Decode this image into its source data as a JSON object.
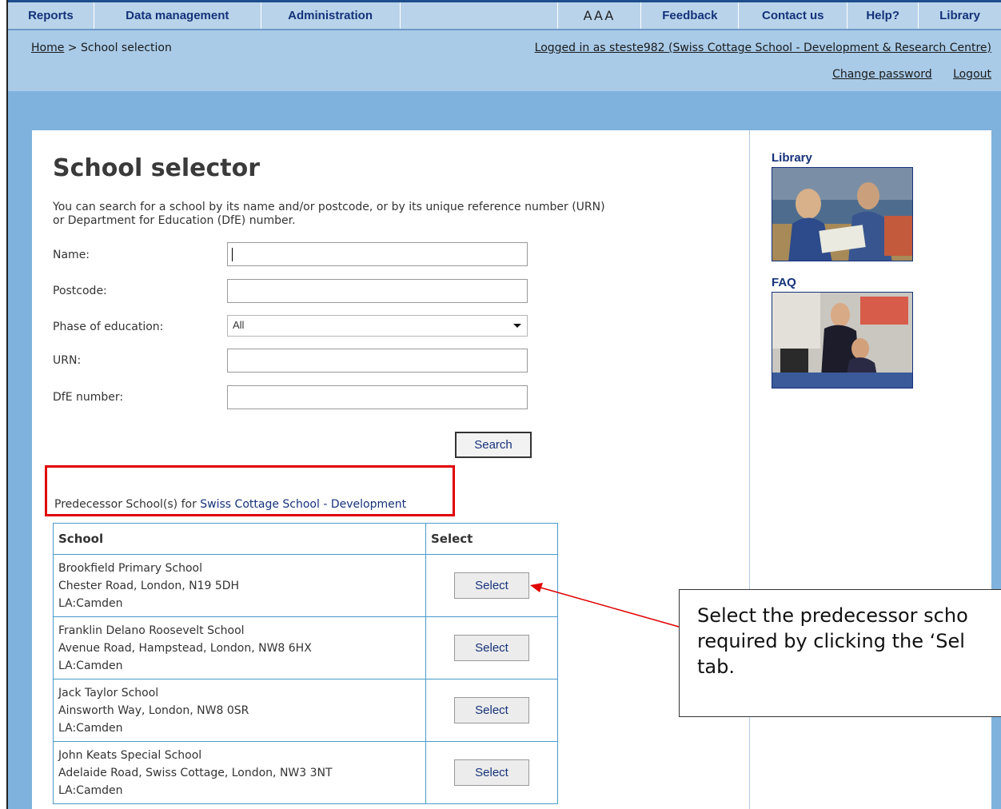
{
  "nav": {
    "items": [
      "Reports",
      "Data management",
      "Administration"
    ],
    "text_size": "AAA",
    "right_items": [
      "Feedback",
      "Contact us",
      "Help?",
      "Library"
    ]
  },
  "breadcrumb": {
    "home": "Home",
    "separator": ">",
    "current": "School selection"
  },
  "account": {
    "login_text": "Logged in as steste982 (Swiss Cottage School - Development & Research Centre)",
    "change_password": "Change password",
    "logout": "Logout"
  },
  "page": {
    "title": "School selector",
    "intro": "You can search for a school by its name and/or postcode, or by its unique reference number (URN) or Department for Education (DfE) number."
  },
  "form": {
    "name_label": "Name:",
    "name_value": "",
    "postcode_label": "Postcode:",
    "postcode_value": "",
    "phase_label": "Phase of education:",
    "phase_value": "All",
    "urn_label": "URN:",
    "urn_value": "",
    "dfe_label": "DfE number:",
    "dfe_value": "",
    "search_button": "Search"
  },
  "predecessor": {
    "prefix": "Predecessor School(s) for",
    "school_name": "Swiss Cottage School - Development"
  },
  "table": {
    "headers": [
      "School",
      "Select"
    ],
    "rows": [
      {
        "name": "Brookfield Primary School",
        "address": "Chester Road, London, N19 5DH",
        "la": "LA:Camden",
        "button": "Select"
      },
      {
        "name": "Franklin Delano Roosevelt School",
        "address": "Avenue Road, Hampstead, London, NW8 6HX",
        "la": "LA:Camden",
        "button": "Select"
      },
      {
        "name": "Jack Taylor School",
        "address": "Ainsworth Way, London, NW8 0SR",
        "la": "LA:Camden",
        "button": "Select"
      },
      {
        "name": "John Keats Special School",
        "address": "Adelaide Road, Swiss Cottage, London, NW3 3NT",
        "la": "LA:Camden",
        "button": "Select"
      }
    ]
  },
  "sidebar": {
    "library_label": "Library",
    "faq_label": "FAQ"
  },
  "callout": {
    "lines": [
      "Select the predecessor scho",
      "required by clicking the ‘Sel",
      "tab."
    ]
  },
  "colors": {
    "nav_text": "#15327a",
    "band": "#a9cbe8",
    "background": "#7fb2dc",
    "highlight": "#e00000",
    "table_border": "#4a9ac9"
  }
}
